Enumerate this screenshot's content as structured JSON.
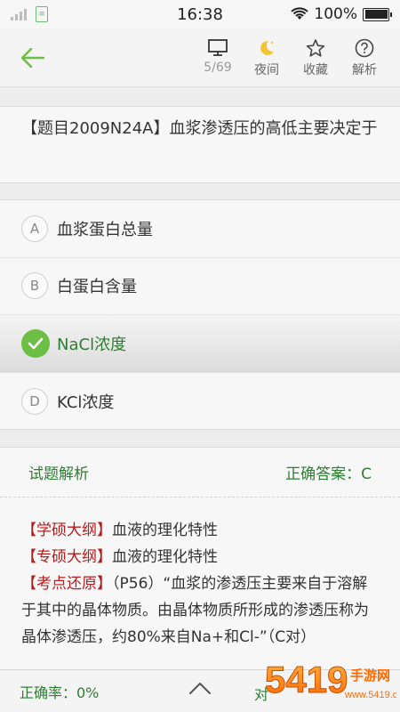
{
  "status_bar": {
    "time": "16:38",
    "battery": "100%",
    "icons": [
      "signal-icon",
      "sim-icon",
      "wifi-icon",
      "battery-icon"
    ]
  },
  "toolbar": {
    "progress": "5/69",
    "night": "夜间",
    "favorite": "收藏",
    "explain": "解析",
    "accent": "#6cbe45"
  },
  "question": {
    "text": "【题目2009N24A】血浆渗透压的高低主要决定于"
  },
  "options": [
    {
      "letter": "A",
      "text": "血浆蛋白总量"
    },
    {
      "letter": "B",
      "text": "白蛋白含量"
    },
    {
      "letter": "C",
      "text": "NaCl浓度"
    },
    {
      "letter": "D",
      "text": "KCl浓度"
    }
  ],
  "analysis": {
    "title": "试题解析",
    "answer": "正确答案：C",
    "items": [
      {
        "tag": "学硕大纲",
        "text": "血液的理化特性"
      },
      {
        "tag": "专硕大纲",
        "text": "血液的理化特性"
      },
      {
        "tag": "考点还原",
        "text": "（P56）“血浆的渗透压主要来自于溶解于其中的晶体物质。由晶体物质所形成的渗透压称为晶体渗透压，约80%来自Na+和Cl-”（C对）"
      }
    ]
  },
  "bottom_bar": {
    "accuracy": "正确率：0%",
    "right": "对"
  },
  "watermark": {
    "text": "5419手游网",
    "url": "www.5419.cn"
  }
}
